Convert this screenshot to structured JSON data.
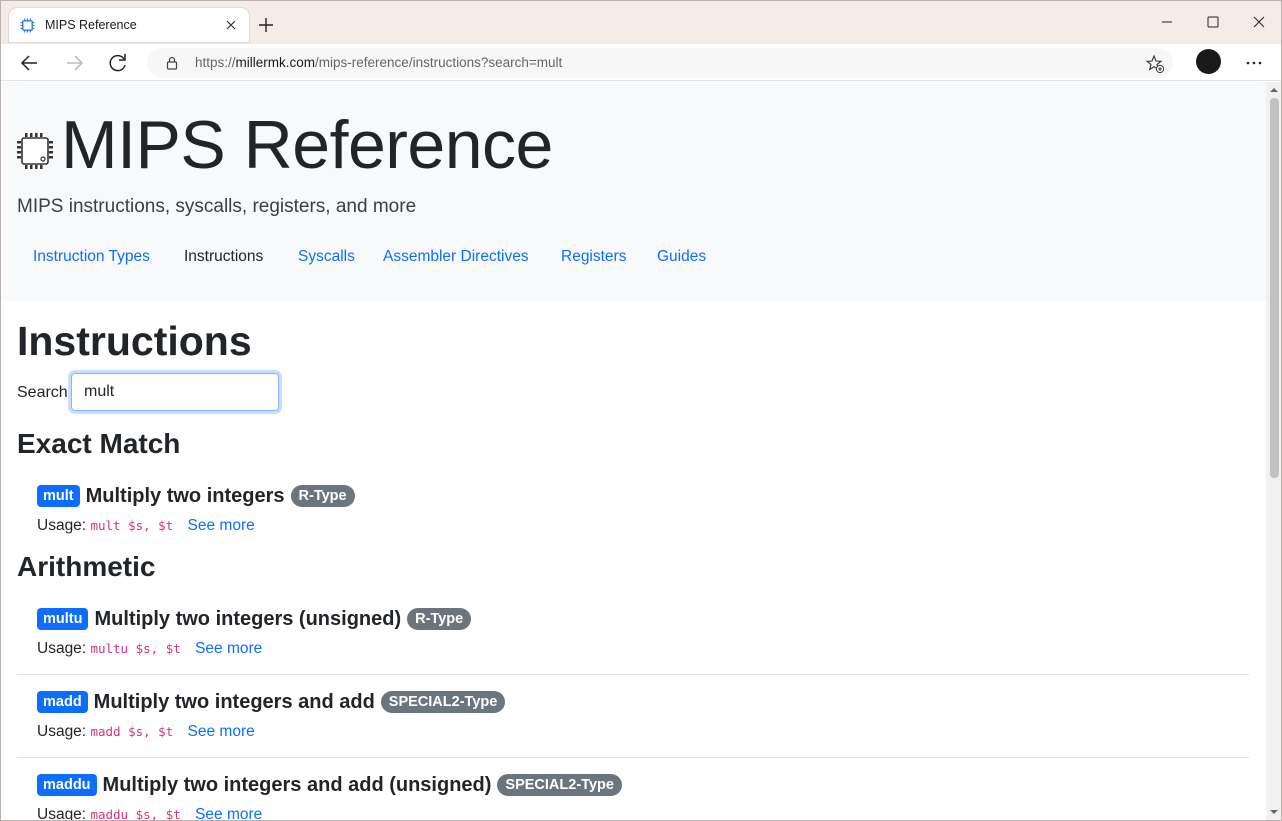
{
  "browser": {
    "tab_title": "MIPS Reference",
    "url_prefix": "https://",
    "url_host": "millermk.com",
    "url_path": "/mips-reference/instructions?search=mult"
  },
  "site": {
    "title": "MIPS Reference",
    "subtitle": "MIPS instructions, syscalls, registers, and more",
    "nav": [
      {
        "label": "Instruction Types",
        "active": false
      },
      {
        "label": "Instructions",
        "active": true
      },
      {
        "label": "Syscalls",
        "active": false
      },
      {
        "label": "Assembler Directives",
        "active": false
      },
      {
        "label": "Registers",
        "active": false
      },
      {
        "label": "Guides",
        "active": false
      }
    ]
  },
  "page": {
    "heading": "Instructions",
    "search_label": "Search",
    "search_value": "mult"
  },
  "sections": [
    {
      "title": "Exact Match",
      "items": [
        {
          "mnemonic": "mult",
          "description": "Multiply two integers",
          "type": "R-Type",
          "usage_label": "Usage:",
          "usage": "mult $s, $t",
          "link": "See more"
        }
      ]
    },
    {
      "title": "Arithmetic",
      "items": [
        {
          "mnemonic": "multu",
          "description": "Multiply two integers (unsigned)",
          "type": "R-Type",
          "usage_label": "Usage:",
          "usage": "multu $s, $t",
          "link": "See more"
        },
        {
          "mnemonic": "madd",
          "description": "Multiply two integers and add",
          "type": "SPECIAL2-Type",
          "usage_label": "Usage:",
          "usage": "madd $s, $t",
          "link": "See more"
        },
        {
          "mnemonic": "maddu",
          "description": "Multiply two integers and add (unsigned)",
          "type": "SPECIAL2-Type",
          "usage_label": "Usage:",
          "usage": "maddu $s, $t",
          "link": "See more"
        }
      ]
    }
  ],
  "colors": {
    "link": "#0d6efd",
    "badge_primary": "#0d6efd",
    "badge_secondary": "#6c757d",
    "code": "#d63384"
  }
}
